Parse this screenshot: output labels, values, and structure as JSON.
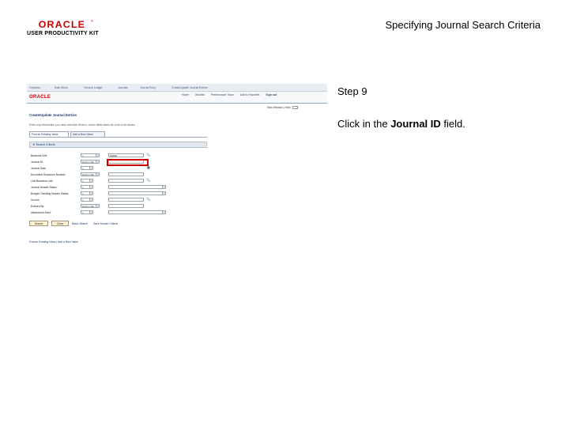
{
  "slide": {
    "logo_brand": "ORACLE",
    "logo_subtitle": "USER PRODUCTIVITY KIT",
    "title": "Specifying Journal Search Criteria",
    "step": "Step 9",
    "instruction_prefix": "Click in the ",
    "instruction_target": "Journal ID",
    "instruction_suffix": " field."
  },
  "app": {
    "brand": "ORACLE",
    "breadcrumb": [
      "Favorites",
      "Main Menu",
      "General Ledger",
      "Journals",
      "Journal Entry",
      "Create/Update Journal Entries"
    ],
    "nav_links": [
      "Home",
      "Worklist",
      "Performance Trace",
      "Add to Favorites",
      "Sign out"
    ],
    "top_right": "New Window | Help",
    "page_title": "Create/Update Journal Entries",
    "page_instruction": "Enter any information you have and click Search. Leave fields blank for a list of all values.",
    "tabs": [
      "Find an Existing Value",
      "Add a New Value"
    ],
    "section": "Search Criteria",
    "fields": [
      {
        "label": "Business Unit:",
        "op": "=",
        "value": "US001"
      },
      {
        "label": "Journal ID:",
        "op": "begins with",
        "value": ""
      },
      {
        "label": "Journal Date:",
        "op": "=",
        "value": ""
      },
      {
        "label": "Document Sequence Number:",
        "op": "begins with",
        "value": ""
      },
      {
        "label": "Line Business Unit:",
        "op": "=",
        "value": ""
      },
      {
        "label": "Journal Header Status:",
        "op": "=",
        "value": ""
      },
      {
        "label": "Budget Checking Header Status:",
        "op": "=",
        "value": ""
      },
      {
        "label": "Source:",
        "op": "=",
        "value": ""
      },
      {
        "label": "Entered By:",
        "op": "begins with",
        "value": ""
      },
      {
        "label": "Attachment Exist:",
        "op": "=",
        "value": ""
      }
    ],
    "buttons": {
      "search": "Search",
      "clear": "Clear"
    },
    "basic_search": "Basic Search",
    "save_criteria": "Save Search Criteria",
    "bottom_links": "Find an Existing Value | Add a New Value"
  }
}
